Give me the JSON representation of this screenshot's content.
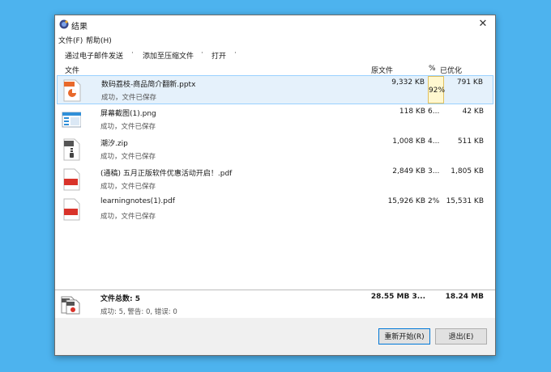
{
  "window": {
    "title": "结果",
    "close_glyph": "✕"
  },
  "menu": {
    "file": "文件(F)",
    "help": "帮助(H)"
  },
  "toolbar": {
    "email": "通过电子邮件发送",
    "dot1": "·",
    "add_zip": "添加至压缩文件",
    "dot2": "·",
    "open": "打开",
    "dot3": "·"
  },
  "columns": {
    "file": "文件",
    "original": "原文件",
    "percent": "%",
    "optimized": "已优化"
  },
  "files": [
    {
      "name": "数码荔枝-商品简介翻新.pptx",
      "status": "成功，文件已保存",
      "original": "9,332 KB",
      "percent": "92%",
      "optimized": "791 KB",
      "icon": "pptx-file-icon"
    },
    {
      "name": "屏幕截图(1).png",
      "status": "成功，文件已保存",
      "original": "118 KB",
      "percent": "6...",
      "optimized": "42 KB",
      "icon": "png-file-icon"
    },
    {
      "name": "潮汐.zip",
      "status": "成功，文件已保存",
      "original": "1,008 KB",
      "percent": "4...",
      "optimized": "511 KB",
      "icon": "zip-file-icon"
    },
    {
      "name": "(通稿) 五月正版软件优惠活动开启！.pdf",
      "status": "成功，文件已保存",
      "original": "2,849 KB",
      "percent": "3...",
      "optimized": "1,805 KB",
      "icon": "pdf-file-icon"
    },
    {
      "name": "learningnotes(1).pdf",
      "status": "成功，文件已保存",
      "original": "15,926 KB",
      "percent": "2%",
      "optimized": "15,531 KB",
      "icon": "pdf-file-icon"
    }
  ],
  "summary": {
    "label": "文件总数: 5",
    "status": "成功: 5, 警告: 0, 错误: 0",
    "original": "28.55 MB 3...",
    "optimized": "18.24 MB"
  },
  "buttons": {
    "restart": "重新开始(R)",
    "exit": "退出(E)"
  },
  "colors": {
    "desktop": "#4db3ee",
    "selection": "#e5f1fb",
    "pdf_red": "#d9332a",
    "pptx_orange": "#e8692b"
  }
}
